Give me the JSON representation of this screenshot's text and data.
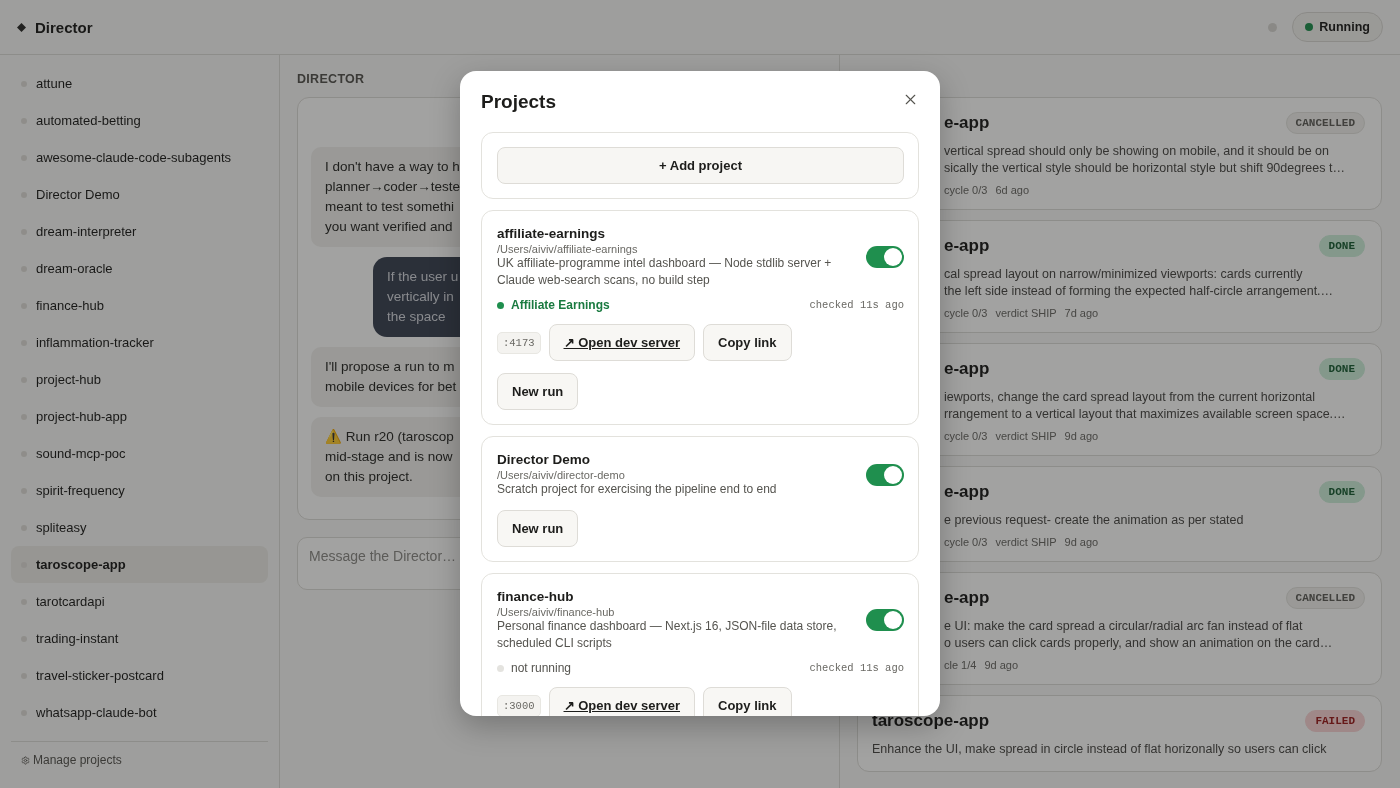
{
  "app": {
    "title": "Director",
    "status": {
      "label": "Running",
      "running": true
    }
  },
  "sidebar": {
    "projects": [
      {
        "name": "attune",
        "selected": false
      },
      {
        "name": "automated-betting",
        "selected": false
      },
      {
        "name": "awesome-claude-code-subagents",
        "selected": false
      },
      {
        "name": "Director Demo",
        "selected": false
      },
      {
        "name": "dream-interpreter",
        "selected": false
      },
      {
        "name": "dream-oracle",
        "selected": false
      },
      {
        "name": "finance-hub",
        "selected": false
      },
      {
        "name": "inflammation-tracker",
        "selected": false
      },
      {
        "name": "project-hub",
        "selected": false
      },
      {
        "name": "project-hub-app",
        "selected": false
      },
      {
        "name": "sound-mcp-poc",
        "selected": false
      },
      {
        "name": "spirit-frequency",
        "selected": false
      },
      {
        "name": "spliteasy",
        "selected": false
      },
      {
        "name": "taroscope-app",
        "selected": true
      },
      {
        "name": "tarotcardapi",
        "selected": false
      },
      {
        "name": "trading-instant",
        "selected": false
      },
      {
        "name": "travel-sticker-postcard",
        "selected": false
      },
      {
        "name": "whatsapp-claude-bot",
        "selected": false
      }
    ],
    "footer": "Manage projects"
  },
  "chat": {
    "heading": "DIRECTOR",
    "messages": [
      {
        "kind": "assistant",
        "lines": [
          "I don't have a way to h",
          "planner→coder→teste",
          "meant to test somethi",
          "you want verified and"
        ]
      },
      {
        "kind": "user",
        "lines": [
          "If the user u",
          "vertically in",
          "the space"
        ]
      },
      {
        "kind": "assistant",
        "lines": [
          "I'll propose a run to m",
          "mobile devices for bet"
        ]
      },
      {
        "kind": "assistant",
        "lines": [
          "⚠️ Run r20 (taroscop",
          "mid-stage and is now",
          "on this project."
        ]
      }
    ],
    "composer": {
      "placeholder": "Message the Director…"
    }
  },
  "runs": [
    {
      "title": "e-app",
      "covered": true,
      "kind": "cancelled",
      "status_label": "CANCELLED",
      "lines": [
        "vertical spread should only be showing on mobile, and it should be on",
        "sically the vertical style should be horizontal style but shift 90degrees t…"
      ],
      "meta": [
        "cycle 0/3",
        "6d ago"
      ]
    },
    {
      "title": "e-app",
      "covered": true,
      "kind": "done",
      "status_label": "DONE",
      "lines": [
        "cal spread layout on narrow/minimized viewports: cards currently",
        "the left side instead of forming the expected half-circle arrangement.…"
      ],
      "meta": [
        "cycle 0/3",
        "verdict SHIP",
        "7d ago"
      ]
    },
    {
      "title": "e-app",
      "covered": true,
      "kind": "done",
      "status_label": "DONE",
      "lines": [
        "iewports, change the card spread layout from the current horizontal",
        "rrangement to a vertical layout that maximizes available screen space.…"
      ],
      "meta": [
        "cycle 0/3",
        "verdict SHIP",
        "9d ago"
      ]
    },
    {
      "title": "e-app",
      "covered": true,
      "kind": "done",
      "status_label": "DONE",
      "lines": [
        "e previous request- create the animation as per stated"
      ],
      "meta": [
        "cycle 0/3",
        "verdict SHIP",
        "9d ago"
      ]
    },
    {
      "title": "e-app",
      "covered": true,
      "kind": "cancelled",
      "status_label": "CANCELLED",
      "lines": [
        "e UI: make the card spread a circular/radial arc fan instead of flat",
        "o users can click cards properly, and show an animation on the card…"
      ],
      "meta": [
        "cle 1/4",
        "9d ago"
      ]
    },
    {
      "title": "taroscope-app",
      "covered": false,
      "kind": "failed",
      "status_label": "FAILED",
      "lines": [
        "Enhance the UI, make spread in circle instead of flat horizonally so users can click"
      ]
    }
  ],
  "modal": {
    "title": "Projects",
    "add_button": "+ Add project",
    "projects": [
      {
        "name": "affiliate-earnings",
        "path": "/Users/aiviv/affiliate-earnings",
        "description": "UK affiliate-programme intel dashboard — Node stdlib server + Claude web-search scans, no build step",
        "enabled": true,
        "server": {
          "running": true,
          "label": "Affiliate Earnings",
          "checked": "checked 11s ago",
          "port": ":4173",
          "open_button": "↗ Open dev server",
          "copy_button": "Copy link"
        },
        "new_run_button": "New run"
      },
      {
        "name": "Director Demo",
        "path": "/Users/aiviv/director-demo",
        "description": "Scratch project for exercising the pipeline end to end",
        "enabled": true,
        "new_run_button": "New run"
      },
      {
        "name": "finance-hub",
        "path": "/Users/aiviv/finance-hub",
        "description": "Personal finance dashboard — Next.js 16, JSON-file data store, scheduled CLI scripts",
        "enabled": true,
        "server": {
          "running": false,
          "label": "not running",
          "checked": "checked 11s ago",
          "port": ":3000",
          "open_button": "↗ Open dev server",
          "copy_button": "Copy link"
        }
      }
    ]
  }
}
